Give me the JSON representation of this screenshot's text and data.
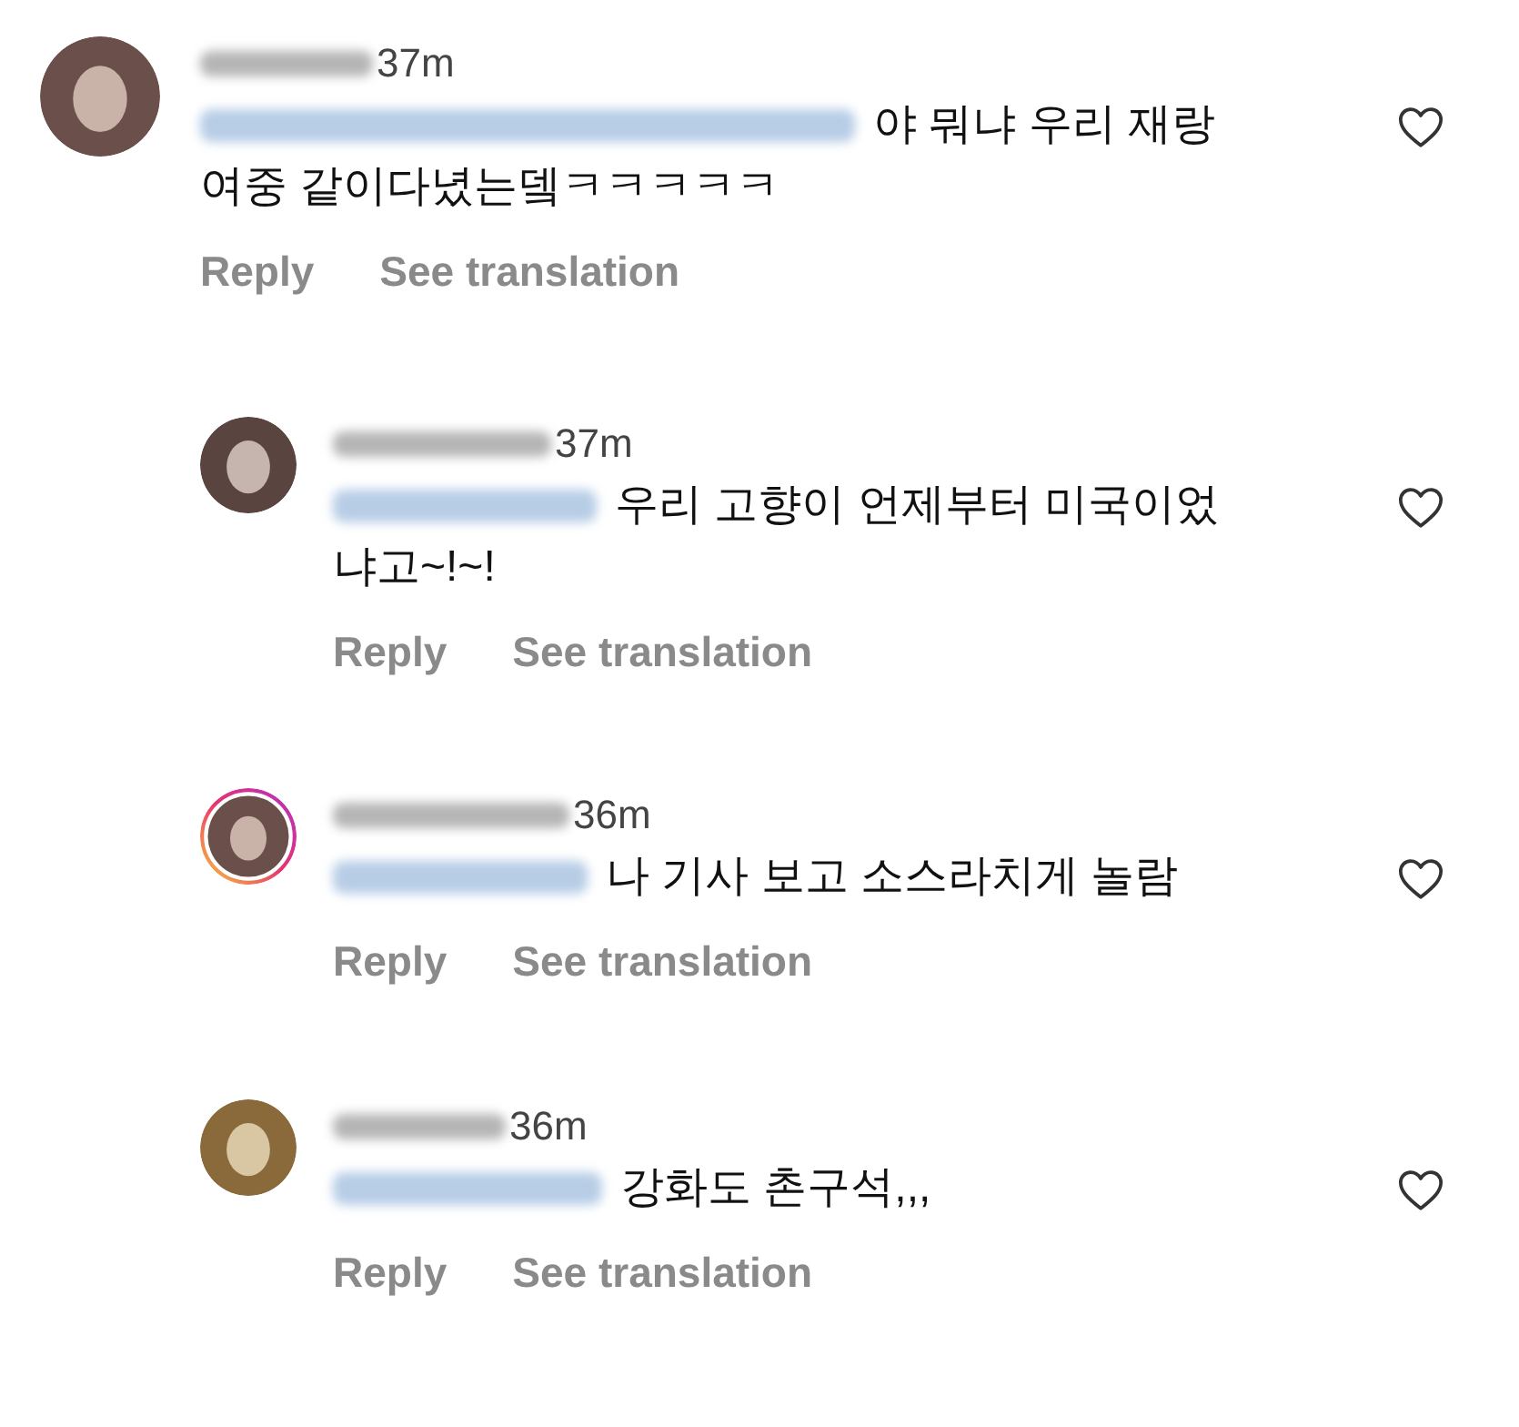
{
  "comments": [
    {
      "time": "37m",
      "text_lines": [
        "야 뭐냐 우리 재랑",
        "여중 같이다녔는뎈ㅋㅋㅋㅋㅋ"
      ],
      "story_ring": false,
      "actions": [
        "Reply",
        "See translation"
      ],
      "replies": [
        {
          "time": "37m",
          "text_lines": [
            "우리 고향이 언제부터 미국이었",
            "냐고~!~!"
          ],
          "story_ring": false,
          "actions": [
            "Reply",
            "See translation"
          ]
        },
        {
          "time": "36m",
          "text_lines": [
            "나 기사 보고 소스라치게 놀람"
          ],
          "story_ring": true,
          "actions": [
            "Reply",
            "See translation"
          ]
        },
        {
          "time": "36m",
          "text_lines": [
            "강화도 촌구석,,,"
          ],
          "story_ring": false,
          "actions": [
            "Reply",
            "See translation"
          ]
        }
      ]
    }
  ]
}
